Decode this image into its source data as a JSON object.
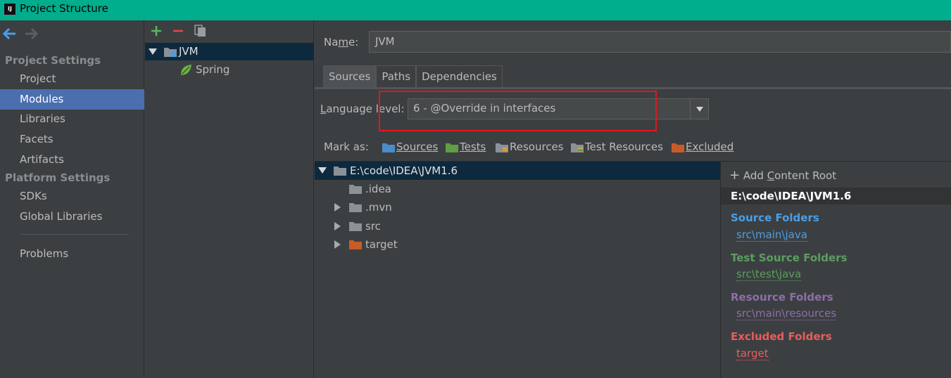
{
  "window": {
    "title": "Project Structure",
    "icon_text": "IJ"
  },
  "nav": {
    "back_icon": "back-arrow-icon",
    "forward_icon": "forward-arrow-icon",
    "project_settings_header": "Project Settings",
    "project_items": [
      "Project",
      "Modules",
      "Libraries",
      "Facets",
      "Artifacts"
    ],
    "selected": "Modules",
    "platform_settings_header": "Platform Settings",
    "platform_items": [
      "SDKs",
      "Global Libraries"
    ],
    "problems": "Problems"
  },
  "modules": {
    "toolbar": [
      "add-icon",
      "remove-icon",
      "copy-icon"
    ],
    "items": [
      {
        "label": "JVM",
        "icon": "module-folder-icon",
        "expanded": true,
        "selected": true
      },
      {
        "label": "Spring",
        "icon": "spring-leaf-icon",
        "indent": 1
      }
    ]
  },
  "main": {
    "name_label_pre": "Na",
    "name_label_mnemonic": "m",
    "name_label_post": "e:",
    "name_value": "JVM",
    "tabs": [
      "Sources",
      "Paths",
      "Dependencies"
    ],
    "active_tab": "Sources",
    "language_label_mnemonic": "L",
    "language_label_rest": "anguage level:",
    "language_value": "6 - @Override in interfaces",
    "mark_as_label": "Mark as:",
    "mark_as": [
      {
        "label": "Sources",
        "mnemonic_index": 0,
        "color": "#4a8cc7"
      },
      {
        "label": "Tests",
        "mnemonic_index": 0,
        "color": "#5f9e41"
      },
      {
        "label": "Resources",
        "mnemonic_index": -1,
        "color": "#8a9197"
      },
      {
        "label": "Test Resources",
        "mnemonic_index": -1,
        "color": "#8a9197"
      },
      {
        "label": "Excluded",
        "mnemonic_index": 0,
        "color": "#c75c28"
      }
    ],
    "tree": [
      {
        "label": "E:\\code\\IDEA\\JVM1.6",
        "arrow": "down",
        "color": "#8a9197",
        "selected": true
      },
      {
        "label": ".idea",
        "arrow": "",
        "color": "#8a9197"
      },
      {
        "label": ".mvn",
        "arrow": "right",
        "color": "#8a9197"
      },
      {
        "label": "src",
        "arrow": "right",
        "color": "#8a9197"
      },
      {
        "label": "target",
        "arrow": "right",
        "color": "#c75c28"
      }
    ],
    "content_roots": {
      "add_label_pre": "Add ",
      "add_label_mnemonic": "C",
      "add_label_post": "ontent Root",
      "root_path": "E:\\code\\IDEA\\JVM1.6",
      "categories": [
        {
          "title": "Source Folders",
          "path": "src\\main\\java",
          "color": "#4a9ee7"
        },
        {
          "title": "Test Source Folders",
          "path": "src\\test\\java",
          "color": "#5c9e60"
        },
        {
          "title": "Resource Folders",
          "path": "src\\main\\resources",
          "color": "#8f6ea8"
        },
        {
          "title": "Excluded Folders",
          "path": "target",
          "color": "#e85d5d"
        }
      ]
    }
  }
}
